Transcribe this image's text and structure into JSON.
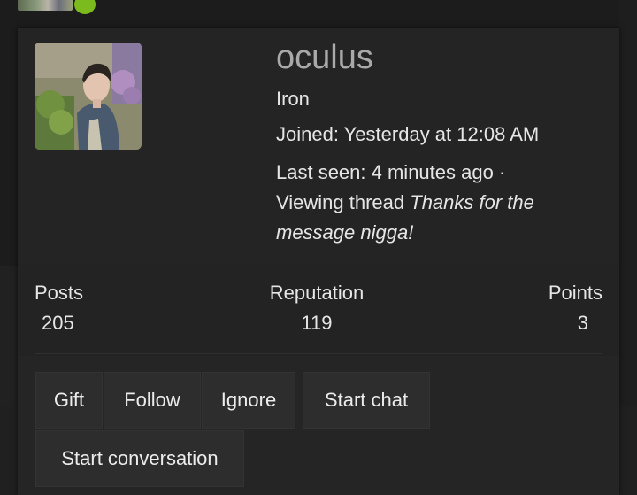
{
  "profile": {
    "username": "oculus",
    "rank": "Iron",
    "joined_text": "Joined: Yesterday at 12:08 AM",
    "last_seen_prefix": "Last seen: 4 minutes ago ·",
    "viewing_prefix": "Viewing thread ",
    "viewing_thread_title": "Thanks for the message nigga!",
    "online_status_color": "#7cbb1e"
  },
  "stats": {
    "posts_label": "Posts",
    "posts_value": "205",
    "reputation_label": "Reputation",
    "reputation_value": "119",
    "points_label": "Points",
    "points_value": "3"
  },
  "actions": {
    "gift": "Gift",
    "follow": "Follow",
    "ignore": "Ignore",
    "start_chat": "Start chat",
    "start_conversation": "Start conversation"
  },
  "icons": {
    "avatar": "user-avatar-photo",
    "online": "online-status-dot"
  }
}
